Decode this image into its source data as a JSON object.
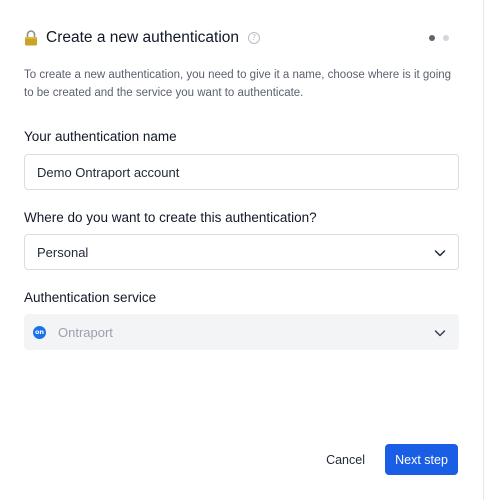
{
  "header": {
    "title": "Create a new authentication",
    "lock_icon": "lock-icon",
    "help_icon": "question-circle-icon",
    "help_glyph": "?",
    "steps": [
      "active",
      "inactive"
    ]
  },
  "description": "To create a new authentication, you need to give it a name, choose where is it going to be created and the service you want to authenticate.",
  "form": {
    "name_label": "Your authentication name",
    "name_value": "Demo Ontraport account",
    "location_label": "Where do you want to create this authentication?",
    "location_value": "Personal",
    "service_label": "Authentication service",
    "service_value": "Ontraport",
    "service_logo_text": "on"
  },
  "footer": {
    "cancel_label": "Cancel",
    "next_label": "Next step"
  },
  "colors": {
    "primary": "#1a5ee6",
    "service_logo": "#1a73e8",
    "lock_gold": "#c9a227"
  }
}
